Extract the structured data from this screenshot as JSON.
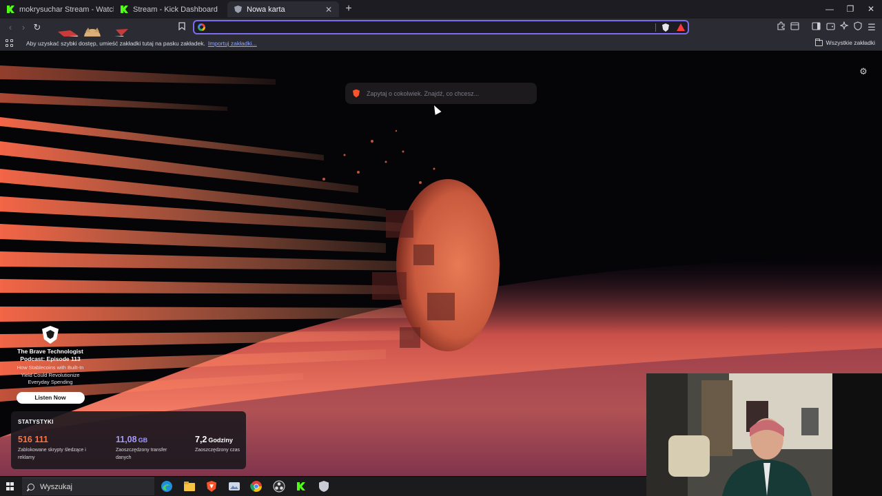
{
  "tabs": [
    {
      "title": "mokrysuchar Stream - Watch Live on",
      "favicon": "kick-icon",
      "active": false
    },
    {
      "title": "Stream - Kick Dashboard",
      "favicon": "kick-icon",
      "active": false
    },
    {
      "title": "Nowa karta",
      "favicon": "brave-shield-icon",
      "active": true
    }
  ],
  "omnibox": {
    "value": "",
    "placeholder": ""
  },
  "bookmarks_bar": {
    "hint": "Aby uzyskać szybki dostęp, umieść zakładki tutaj na pasku zakładek.",
    "import_link": "Importuj zakładki...",
    "all_bookmarks": "Wszystkie zakładki"
  },
  "search": {
    "placeholder": "Zapytaj o cokolwiek. Znajdź, co chcesz..."
  },
  "promo": {
    "title": "The Brave Technologist Podcast: Episode 113",
    "subtitle": "How Stablecoins with Built-In Yield Could Revolutionize Everyday Spending",
    "button": "Listen Now"
  },
  "stats": {
    "title": "STATYSTYKI",
    "items": [
      {
        "value": "516 111",
        "unit": "",
        "color": "#fb7544",
        "desc": "Zablokowane skrypty śledzące i reklamy"
      },
      {
        "value": "11,08",
        "unit": "GB",
        "color": "#a59cf9",
        "desc": "Zaoszczędzony transfer danych"
      },
      {
        "value": "7,2",
        "unit": "Godziny",
        "color": "#ffffff",
        "desc": "Zaoszczędzony czas"
      }
    ]
  },
  "taskbar": {
    "search_label": "Wyszukaj",
    "apps": [
      "edge-icon",
      "file-explorer-icon",
      "brave-icon",
      "photos-icon",
      "chrome-icon",
      "obs-icon",
      "kick-icon",
      "app-icon"
    ]
  },
  "colors": {
    "accent": "#7b6cf0",
    "brave_orange": "#fb542b",
    "kick_green": "#53fc18"
  }
}
